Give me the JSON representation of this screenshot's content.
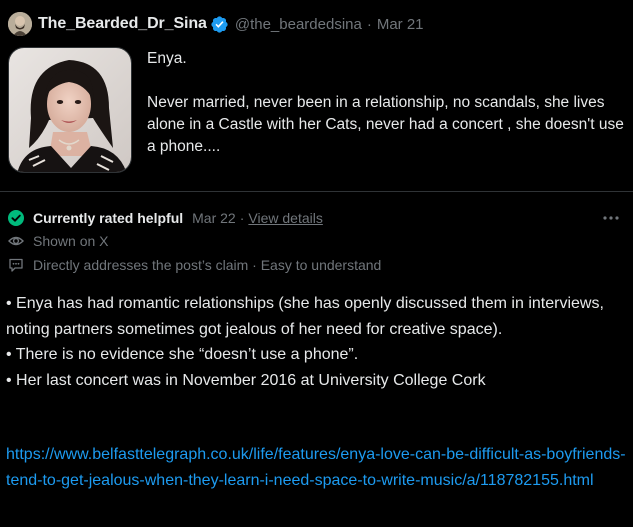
{
  "tweet": {
    "display_name": "The_Bearded_Dr_Sina",
    "handle": "@the_beardedsina",
    "separator": "·",
    "date": "Mar 21",
    "text_line1": "Enya.",
    "text_line2": "Never married,  never been in a relationship, no scandals, she lives alone in a Castle with her Cats, never had a concert , she doesn't use a phone....",
    "media_description": "photo",
    "verified_color": "#1d9bf0"
  },
  "community_note": {
    "status_label": "Currently rated helpful",
    "status_date": "Mar 22",
    "status_separator": "·",
    "view_details": "View details",
    "shown_on": "Shown on X",
    "reasons": "Directly addresses the post’s claim · Easy to understand",
    "bullets": [
      "• Enya has had romantic relationships (she has openly discussed them in interviews, noting partners sometimes got jealous of her need for creative space).",
      "• There is no evidence she “doesn’t use a phone”.",
      "• Her last concert was in November 2016 at University College Cork"
    ],
    "link": "https://www.belfasttelegraph.co.uk/life/features/enya-love-can-be-difficult-as-boyfriends-tend-to-get-jealous-when-they-learn-i-need-space-to-write-music/a/118782155.html",
    "helpful_color": "#00ba7c",
    "link_color": "#1d9bf0"
  },
  "icons": {
    "verified": "verified-badge-icon",
    "check": "check-circle-icon",
    "eye": "eye-icon",
    "message": "message-square-icon",
    "more": "more-horizontal-icon"
  }
}
